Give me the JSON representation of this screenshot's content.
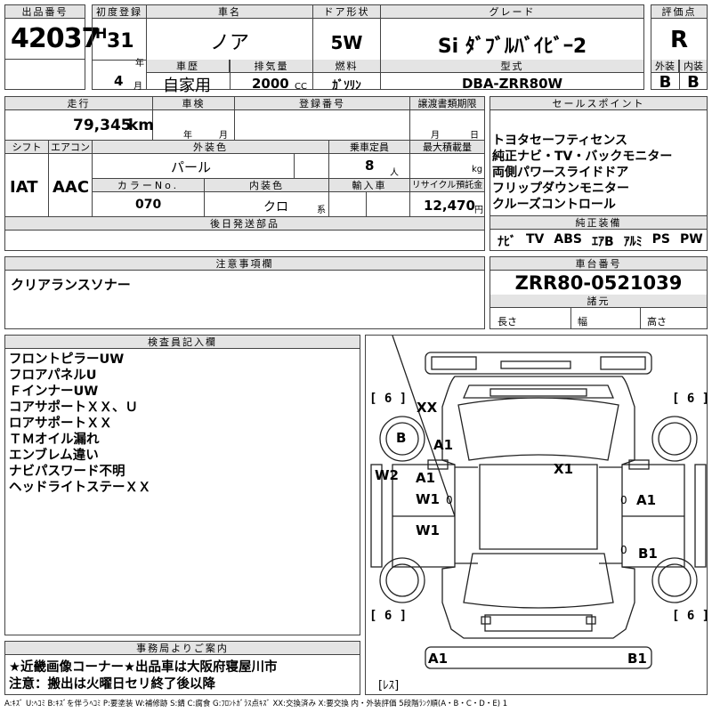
{
  "top": {
    "lot_label": "出品番号",
    "lot_no": "42037",
    "reg_label": "初度登録",
    "era": "H",
    "reg_year": "31",
    "year_unit": "年",
    "reg_month": "4",
    "month_unit": "月",
    "name_label": "車名",
    "car_name": "ノア",
    "history_label": "車歴",
    "history": "自家用",
    "disp_label": "排気量",
    "displacement": "2000",
    "cc": "CC",
    "door_label": "ドア形状",
    "door": "5W",
    "fuel_label": "燃料",
    "fuel": "ｶﾞｿﾘﾝ",
    "grade_label": "グレード",
    "grade": "Si ﾀﾞﾌﾞﾙﾊﾞｲﾋﾞｰ2",
    "model_label": "型式",
    "model": "DBA-ZRR80W",
    "score_label": "評価点",
    "score": "R",
    "ext_label": "外装",
    "ext": "B",
    "int_label": "内装",
    "int": "B"
  },
  "mid": {
    "mileage_label": "走行",
    "mileage": "79,345",
    "km": "km",
    "inspection_label": "車検",
    "insp_year": "年",
    "insp_month": "月",
    "regno_label": "登録番号",
    "transfer_label": "譲渡書類期限",
    "tr_month": "月",
    "tr_day": "日",
    "shift_label": "シフト",
    "shift": "IAT",
    "ac_label": "エアコン",
    "ac": "AAC",
    "color_label": "外装色",
    "color": "パール",
    "capacity_label": "乗車定員",
    "capacity": "8",
    "person": "人",
    "load_label": "最大積載量",
    "kg": "kg",
    "colorno_label": "カラーNo.",
    "color_no": "070",
    "intcolor_label": "内装色",
    "int_color": "クロ",
    "kei": "系",
    "import_label": "輸入車",
    "recycle_label": "リサイクル預託金",
    "recycle": "12,470",
    "yen": "円",
    "later_label": "後日発送部品"
  },
  "sales": {
    "label": "セールスポイント",
    "items": [
      "トヨタセーフティセンス",
      "純正ナビ・TV・バックモニター",
      "両側パワースライドドア",
      "フリップダウンモニター",
      "クルーズコントロール"
    ]
  },
  "equip": {
    "label": "純正装備",
    "items": [
      "ﾅﾋﾞ",
      "TV",
      "ABS",
      "ｴｱB",
      "ｱﾙﾐ",
      "PS",
      "PW"
    ]
  },
  "notes": {
    "label": "注意事項欄",
    "text": "クリアランスソナー"
  },
  "chassis": {
    "label": "車台番号",
    "number": "ZRR80-0521039",
    "spec_label": "諸元",
    "len": "長さ",
    "wid": "幅",
    "hei": "高さ"
  },
  "inspector": {
    "label": "検査員記入欄",
    "lines": [
      "フロントピラーUW",
      "フロアパネルU",
      "ＦインナーUW",
      "コアサポートＸＸ、Ｕ",
      "ロアサポートＸＸ",
      "ＴＭオイル漏れ",
      "エンブレム違い",
      "ナビパスワード不明",
      "ヘッドライトステーＸＸ"
    ]
  },
  "diagram": {
    "tire": "6",
    "marks": {
      "xx": "XX",
      "b": "B",
      "a1_fl": "A1",
      "x1": "X1",
      "w2": "W2",
      "a1_l": "A1",
      "w1_l": "W1",
      "zero_l1": "0",
      "zero_r1": "0",
      "a1_r": "A1",
      "w1_l2": "W1",
      "zero_r2": "0",
      "b1_r": "B1",
      "a1_bl": "A1",
      "b1_br": "B1",
      "less": "[ﾚｽ]"
    }
  },
  "office": {
    "label": "事務局よりご案内",
    "line1": "★近畿画像コーナー★出品車は大阪府寝屋川市",
    "line2": "注意：搬出は火曜日セリ終了後以降"
  },
  "legend": "A:ｷｽﾞ U:ﾍｺﾐ B:ｷｽﾞを伴うﾍｺﾐ P:要塗装 W:補修跡 S:錆 C:腐食 G:ﾌﾛﾝﾄｶﾞﾗｽ点ｷｽﾞ XX:交換済み X:要交換 内・外装評価 5段階ﾗﾝｸ順(A・B・C・D・E) 1"
}
